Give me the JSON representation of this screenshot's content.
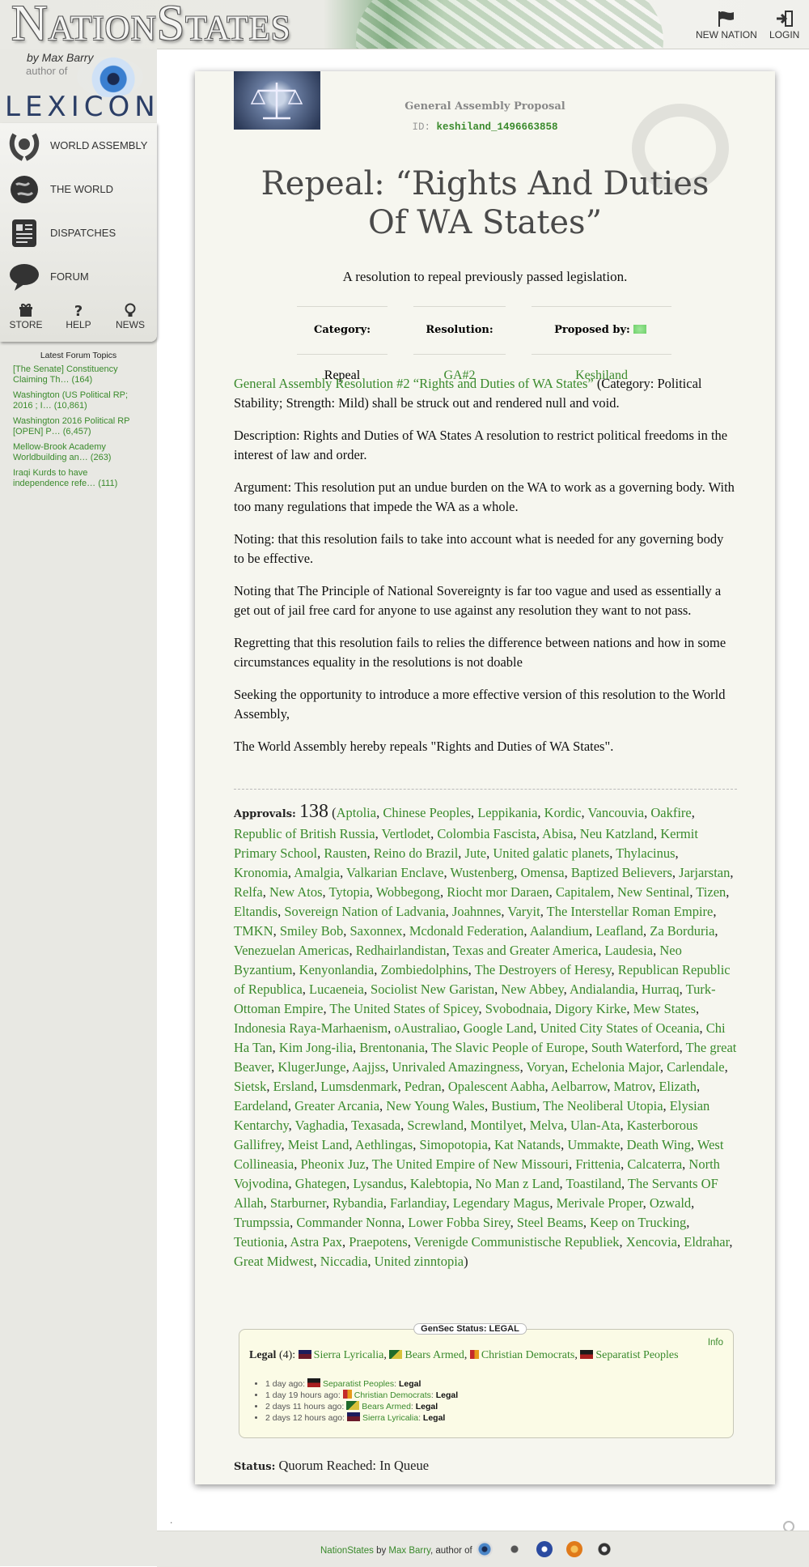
{
  "header": {
    "site_title": "NationStates",
    "new_nation_label": "NEW NATION",
    "login_label": "LOGIN"
  },
  "sidebar": {
    "by_line": "by Max Barry",
    "author_of": "author of",
    "lexicon": "LEXICON",
    "nav": [
      {
        "label": "WORLD ASSEMBLY",
        "icon": "world-assembly-icon"
      },
      {
        "label": "THE WORLD",
        "icon": "globe-icon"
      },
      {
        "label": "DISPATCHES",
        "icon": "newspaper-icon"
      },
      {
        "label": "FORUM",
        "icon": "speech-bubble-icon"
      }
    ],
    "small": [
      {
        "label": "STORE",
        "icon": "gift-icon"
      },
      {
        "label": "HELP",
        "icon": "question-icon"
      },
      {
        "label": "NEWS",
        "icon": "lightbulb-icon"
      }
    ],
    "forum_heading": "Latest Forum Topics",
    "forum_topics": [
      "[The Senate] Constituency Claiming Th… (164)",
      "Washington (US Political RP; 2016 ; I… (10,861)",
      "Washington 2016 Political RP [OPEN] P… (6,457)",
      "Mellow-Brook Academy Worldbuilding an… (263)",
      "Iraqi Kurds to have independence refe… (111)"
    ]
  },
  "proposal": {
    "kind": "General Assembly Proposal",
    "id_label": "ID:",
    "id_value": "keshiland_1496663858",
    "title": "Repeal: “Rights And Duties Of WA States”",
    "subtitle": "A resolution to repeal previously passed legislation.",
    "category_label": "Category:",
    "category_value": "Repeal",
    "resolution_label": "Resolution:",
    "resolution_value": "GA#2",
    "proposed_label": "Proposed by:",
    "proposed_value": "Keshiland",
    "repeal_link": "General Assembly Resolution #2 “Rights and Duties of WA States”",
    "repeal_rest": " (Category: Political Stability; Strength: Mild) shall be struck out and rendered null and void.",
    "paragraphs": [
      "Description: Rights and Duties of WA States A resolution to restrict political freedoms in the interest of law and order.",
      "Argument: This resolution put an undue burden on the WA to work as a governing body. With too many regulations that impede the WA as a whole.",
      "Noting: that this resolution fails to take into account what is needed for any governing body to be effective.",
      "Noting that The Principle of National Sovereignty is far too vague and used as essentially a get out of jail free card for anyone to use against any resolution they want to not pass.",
      "Regretting that this resolution fails to relies the difference between nations and how in some circumstances equality in the resolutions is not doable",
      "Seeking the opportunity to introduce a more effective version of this resolution to the World Assembly,",
      "The World Assembly hereby repeals \"Rights and Duties of WA States\"."
    ],
    "approvals_label": "Approvals:",
    "approvals_count": "138",
    "approvals": [
      "Aptolia",
      "Chinese Peoples",
      "Leppikania",
      "Kordic",
      "Vancouvia",
      "Oakfire",
      "Republic of British Russia",
      "Vertlodet",
      "Colombia Fascista",
      "Abisa",
      "Neu Katzland",
      "Kermit Primary School",
      "Rausten",
      "Reino do Brazil",
      "Jute",
      "United galatic planets",
      "Thylacinus",
      "Kronomia",
      "Amalgia",
      "Valkarian Enclave",
      "Wustenberg",
      "Omensa",
      "Baptized Believers",
      "Jarjarstan",
      "Relfa",
      "New Atos",
      "Tytopia",
      "Wobbegong",
      "Riocht mor Daraen",
      "Capitalem",
      "New Sentinal",
      "Tizen",
      "Eltandis",
      "Sovereign Nation of Ladvania",
      "Joahnnes",
      "Varyit",
      "The Interstellar Roman Empire",
      "TMKN",
      "Smiley Bob",
      "Saxonnex",
      "Mcdonald Federation",
      "Aalandium",
      "Leafland",
      "Za Borduria",
      "Venezuelan Americas",
      "Redhairlandistan",
      "Texas and Greater America",
      "Laudesia",
      "Neo Byzantium",
      "Kenyonlandia",
      "Zombiedolphins",
      "The Destroyers of Heresy",
      "Republican Republic of Republica",
      "Lucaeneia",
      "Sociolist New Garistan",
      "New Abbey",
      "Andialandia",
      "Hurraq",
      "Turk-Ottoman Empire",
      "The United States of Spicey",
      "Svobodnaia",
      "Digory Kirke",
      "Mew States",
      "Indonesia Raya-Marhaenism",
      "oAustraliao",
      "Google Land",
      "United City States of Oceania",
      "Chi Ha Tan",
      "Kim Jong-ilia",
      "Brentonania",
      "The Slavic People of Europe",
      "South Waterford",
      "The great Beaver",
      "KlugerJunge",
      "Aajjss",
      "Unrivaled Amazingness",
      "Voryan",
      "Echelonia Major",
      "Carlendale",
      "Sietsk",
      "Ersland",
      "Lumsdenmark",
      "Pedran",
      "Opalescent Aabha",
      "Aelbarrow",
      "Matrov",
      "Elizath",
      "Eardeland",
      "Greater Arcania",
      "New Young Wales",
      "Bustium",
      "The Neoliberal Utopia",
      "Elysian Kentarchy",
      "Vaghadia",
      "Texasada",
      "Screwland",
      "Montilyet",
      "Melva",
      "Ulan-Ata",
      "Kasterborous Gallifrey",
      "Meist Land",
      "Aethlingas",
      "Simopotopia",
      "Kat Natands",
      "Ummakte",
      "Death Wing",
      "West Collineasia",
      "Pheonix Juz",
      "The United Empire of New Missouri",
      "Frittenia",
      "Calcaterra",
      "North Vojvodina",
      "Ghategen",
      "Lysandus",
      "Kalebtopia",
      "No Man z Land",
      "Toastiland",
      "The Servants OF Allah",
      "Starburner",
      "Rybandia",
      "Farlandiay",
      "Legendary Magus",
      "Merivale Proper",
      "Ozwald",
      "Trumpssia",
      "Commander Nonna",
      "Lower Fobba Sirey",
      "Steel Beams",
      "Keep on Trucking",
      "Teutionia",
      "Astra Pax",
      "Praepotens",
      "Verenigde Communistische Republiek",
      "Xencovia",
      "Eldrahar",
      "Great Midwest",
      "Niccadia",
      "United zinntopia"
    ],
    "status_label": "Status:",
    "status_value": "Quorum Reached: In Queue"
  },
  "gensec": {
    "badge": "GenSec Status: LEGAL",
    "info": "Info",
    "legal_label": "Legal",
    "legal_count": "(4):",
    "voters": [
      "Sierra Lyricalia",
      "Bears Armed",
      "Christian Democrats",
      "Separatist Peoples"
    ],
    "log": [
      {
        "when": "1 day ago:",
        "nation": "Separatist Peoples",
        "verdict": "Legal"
      },
      {
        "when": "1 day 19 hours ago:",
        "nation": "Christian Democrats",
        "verdict": "Legal"
      },
      {
        "when": "2 days 11 hours ago:",
        "nation": "Bears Armed",
        "verdict": "Legal"
      },
      {
        "when": "2 days 12 hours ago:",
        "nation": "Sierra Lyricalia",
        "verdict": "Legal"
      }
    ]
  },
  "footer": {
    "site": "NationStates",
    "by": "by",
    "author": "Max Barry",
    "author_of": ", author of"
  },
  "colors": {
    "link_green": "#3a8a2c",
    "card_bg": "#f6f6ef",
    "sidebar_bg": "#e8e8e3"
  }
}
